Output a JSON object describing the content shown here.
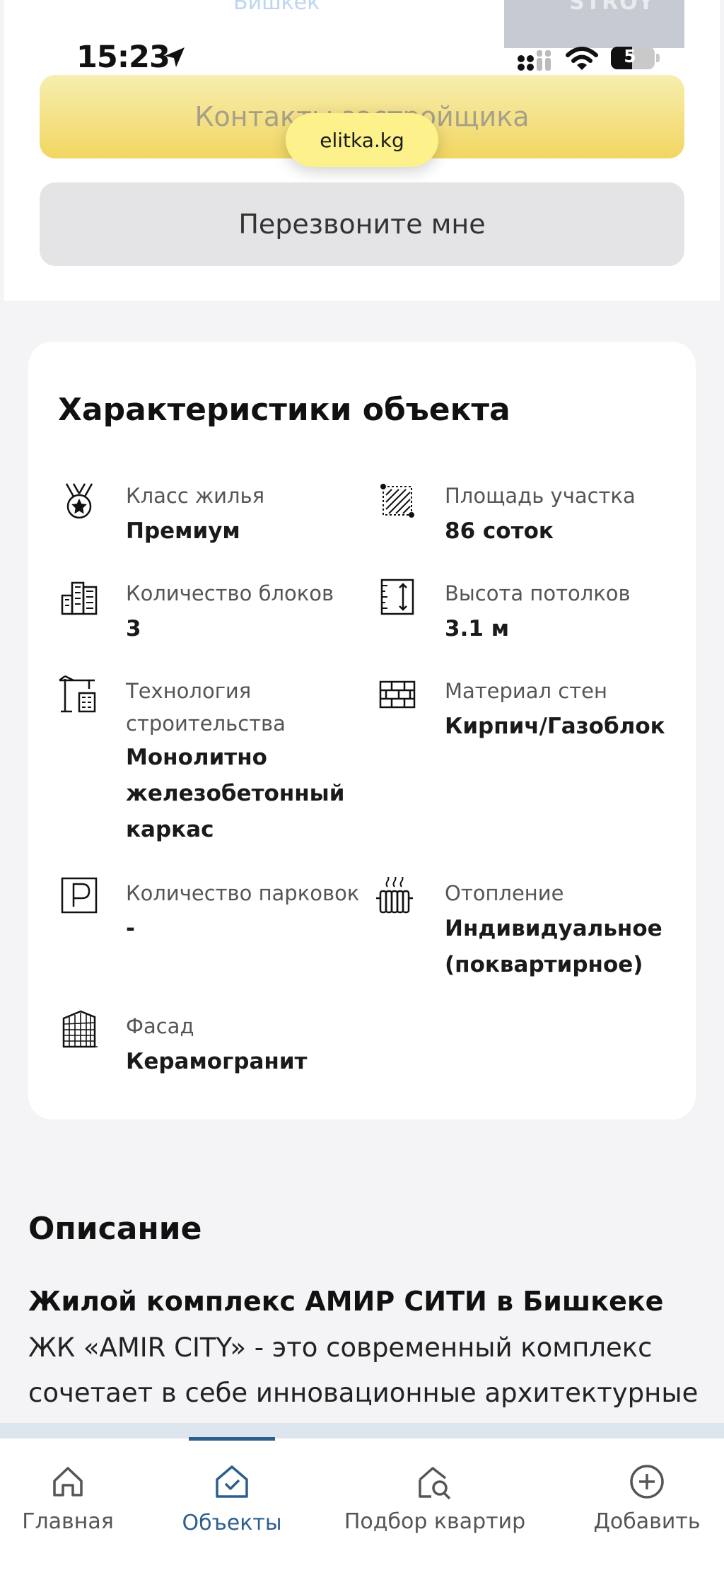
{
  "header": {
    "faded_city": "Бишкек",
    "faded_logo": "STROY"
  },
  "status_bar": {
    "time": "15:23",
    "battery": "5"
  },
  "actions": {
    "contact_button": "Контакты застройщика",
    "site_badge": "elitka.kg",
    "callback_button": "Перезвоните мне"
  },
  "characteristics": {
    "title": "Характеристики объекта",
    "housing_class": {
      "label": "Класс жилья",
      "value": "Премиум",
      "icon": "medal-icon"
    },
    "plot_area": {
      "label": "Площадь участка",
      "value": "86 соток",
      "icon": "area-icon"
    },
    "blocks": {
      "label": "Количество блоков",
      "value": "3",
      "icon": "buildings-icon"
    },
    "ceiling_height": {
      "label": "Высота потолков",
      "value": "3.1 м",
      "icon": "ceiling-height-icon"
    },
    "technology": {
      "label_line1": "Технология",
      "label_line2": "строительства",
      "value_line1": "Монолитно",
      "value_line2": "железобетонный",
      "value_line3": "каркас",
      "icon": "crane-icon"
    },
    "wall_material": {
      "label": "Материал стен",
      "value": "Кирпич/Газоблок",
      "icon": "brick-wall-icon"
    },
    "parking": {
      "label": "Количество парковок",
      "value": "-",
      "icon": "parking-icon"
    },
    "heating": {
      "label": "Отопление",
      "value_line1": "Индивидуальное",
      "value_line2": "(поквартирное)",
      "icon": "radiator-icon"
    },
    "facade": {
      "label": "Фасад",
      "value": "Керамогранит",
      "icon": "facade-icon"
    }
  },
  "description": {
    "title": "Описание",
    "subtitle": "Жилой комплекс АМИР СИТИ в Бишкеке",
    "line1": "ЖК «AMIR CITY» - это современный комплекс",
    "line2": "сочетает в себе инновационные архитектурные"
  },
  "tab_bar": {
    "active_color": "#2c5f8f",
    "items": [
      {
        "label": "Главная",
        "icon": "home-icon"
      },
      {
        "label": "Объекты",
        "icon": "objects-icon"
      },
      {
        "label": "Подбор квартир",
        "icon": "search-home-icon"
      },
      {
        "label": "Добавить",
        "icon": "add-icon"
      }
    ]
  }
}
